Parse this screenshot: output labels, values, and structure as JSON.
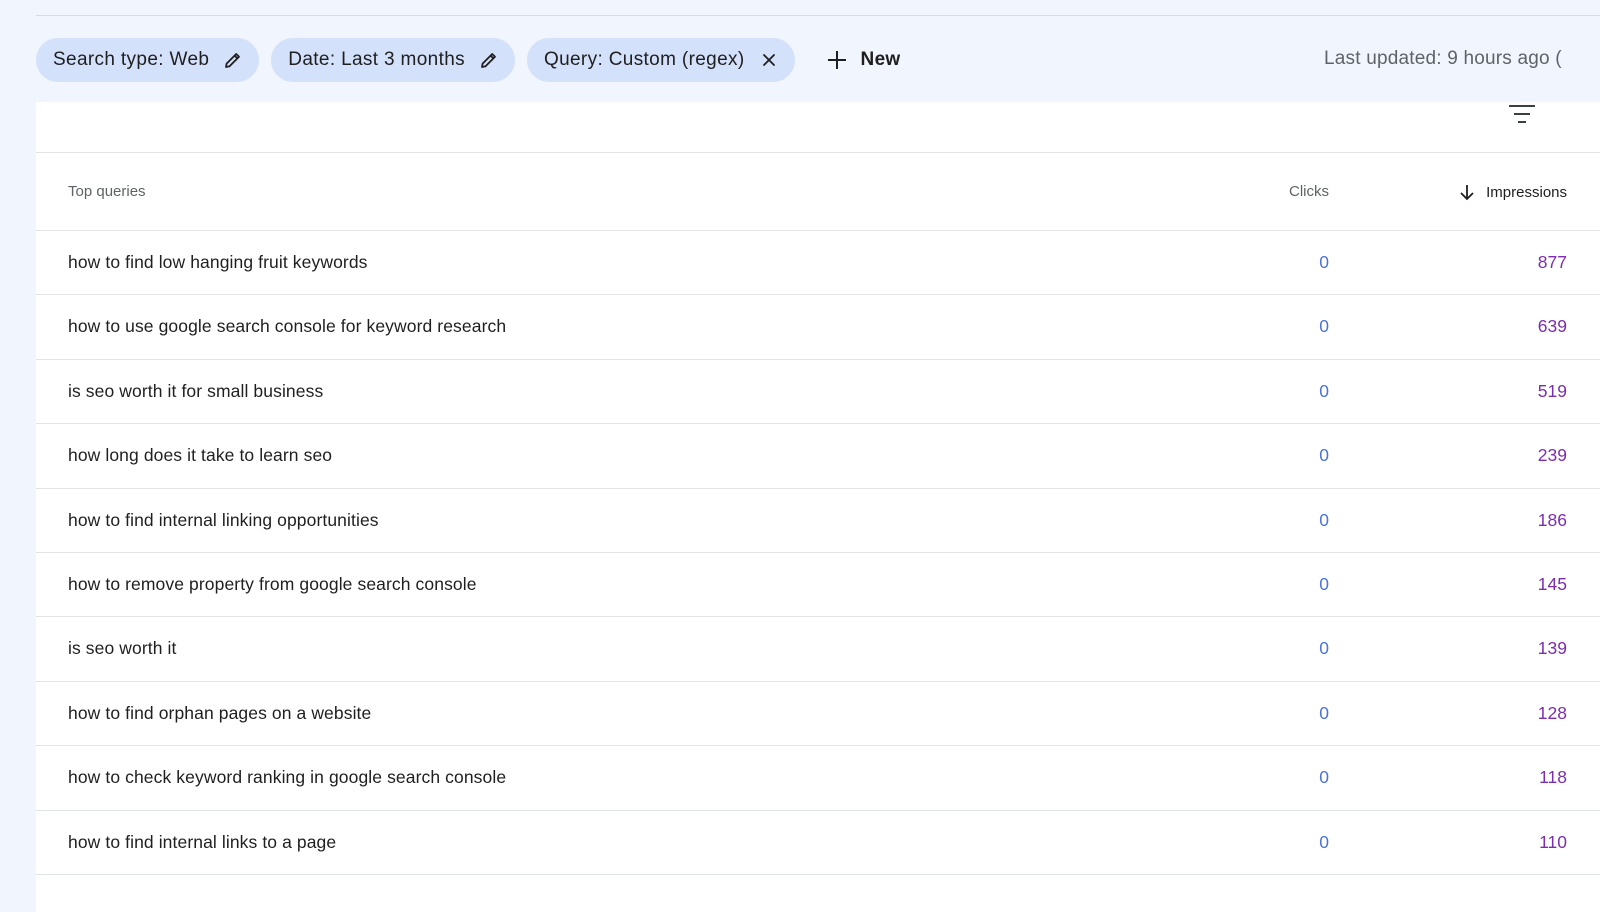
{
  "filters": {
    "chips": [
      {
        "label": "Search type: Web",
        "icon": "pencil-icon"
      },
      {
        "label": "Date: Last 3 months",
        "icon": "pencil-icon"
      },
      {
        "label": "Query: Custom (regex)",
        "icon": "close-icon"
      }
    ],
    "new_label": "New",
    "last_updated": "Last updated: 9 hours ago ("
  },
  "table": {
    "headers": {
      "query": "Top queries",
      "clicks": "Clicks",
      "impressions": "Impressions"
    },
    "sort": {
      "column": "impressions",
      "direction": "descending",
      "icon": "arrow-down-icon"
    },
    "rows": [
      {
        "query": "how to find low hanging fruit keywords",
        "clicks": "0",
        "impressions": "877"
      },
      {
        "query": "how to use google search console for keyword research",
        "clicks": "0",
        "impressions": "639"
      },
      {
        "query": "is seo worth it for small business",
        "clicks": "0",
        "impressions": "519"
      },
      {
        "query": "how long does it take to learn seo",
        "clicks": "0",
        "impressions": "239"
      },
      {
        "query": "how to find internal linking opportunities",
        "clicks": "0",
        "impressions": "186"
      },
      {
        "query": "how to remove property from google search console",
        "clicks": "0",
        "impressions": "145"
      },
      {
        "query": "is seo worth it",
        "clicks": "0",
        "impressions": "139"
      },
      {
        "query": "how to find orphan pages on a website",
        "clicks": "0",
        "impressions": "128"
      },
      {
        "query": "how to check keyword ranking in google search console",
        "clicks": "0",
        "impressions": "118"
      },
      {
        "query": "how to find internal links to a page",
        "clicks": "0",
        "impressions": "110"
      }
    ]
  },
  "colors": {
    "background": "#f1f5fd",
    "chip": "#d4e1fb",
    "clicks": "#4a72d8",
    "impressions": "#7b2dae"
  }
}
